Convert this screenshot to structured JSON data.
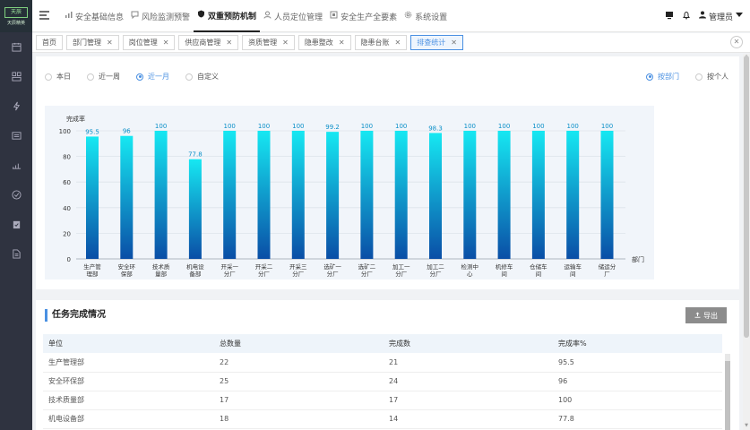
{
  "logo": {
    "mark": "天辰",
    "text": "天辰精英"
  },
  "sidebar": {
    "icons": [
      "calendar-icon",
      "layout-icon",
      "lightning-icon",
      "list-icon",
      "signal-icon",
      "check-circle-icon",
      "clipboard-check-icon",
      "document-icon"
    ]
  },
  "nav": [
    {
      "label": "安全基础信息",
      "icon": "bar-chart-icon"
    },
    {
      "label": "风险监测预警",
      "icon": "comment-icon"
    },
    {
      "label": "双重预防机制",
      "icon": "shield-icon",
      "active": true
    },
    {
      "label": "人员定位管理",
      "icon": "user-location-icon"
    },
    {
      "label": "安全生产全要素",
      "icon": "grid-icon"
    },
    {
      "label": "系统设置",
      "icon": "gear-icon"
    }
  ],
  "user": {
    "name": "管理员"
  },
  "tabs": [
    {
      "label": "首页",
      "closable": false
    },
    {
      "label": "部门管理",
      "closable": true
    },
    {
      "label": "岗位管理",
      "closable": true
    },
    {
      "label": "供应商管理",
      "closable": true
    },
    {
      "label": "资质管理",
      "closable": true
    },
    {
      "label": "隐患整改",
      "closable": true
    },
    {
      "label": "隐患台账",
      "closable": true
    },
    {
      "label": "排查统计",
      "closable": true,
      "active": true
    }
  ],
  "filters": {
    "period": [
      "本日",
      "近一周",
      "近一月",
      "自定义"
    ],
    "period_selected": "近一月",
    "group": [
      "按部门",
      "按个人"
    ],
    "group_selected": "按部门"
  },
  "chart_data": {
    "type": "bar",
    "ylabel": "完成率",
    "xlabel": "部门",
    "ylim": [
      0,
      100
    ],
    "yticks": [
      0,
      20,
      40,
      60,
      80,
      100
    ],
    "categories": [
      "生产管理部",
      "安全环保部",
      "技术质量部",
      "机电设备部",
      "开采一分厂",
      "开采二分厂",
      "开采三分厂",
      "选矿一分厂",
      "选矿二分厂",
      "加工一分厂",
      "加工二分厂",
      "检测中心",
      "机修车间",
      "仓储车间",
      "运输车间",
      "储运分厂"
    ],
    "values": [
      95.5,
      96,
      100,
      77.8,
      100,
      100,
      100,
      99.2,
      100,
      100,
      98.3,
      100,
      100,
      100,
      100,
      100
    ],
    "gradient": [
      "#16e8f2",
      "#0a4ea6"
    ]
  },
  "table": {
    "title": "任务完成情况",
    "export_label": "导出",
    "columns": [
      "单位",
      "总数量",
      "完成数",
      "完成率%"
    ],
    "rows": [
      [
        "生产管理部",
        "22",
        "21",
        "95.5"
      ],
      [
        "安全环保部",
        "25",
        "24",
        "96"
      ],
      [
        "技术质量部",
        "17",
        "17",
        "100"
      ],
      [
        "机电设备部",
        "18",
        "14",
        "77.8"
      ]
    ]
  }
}
